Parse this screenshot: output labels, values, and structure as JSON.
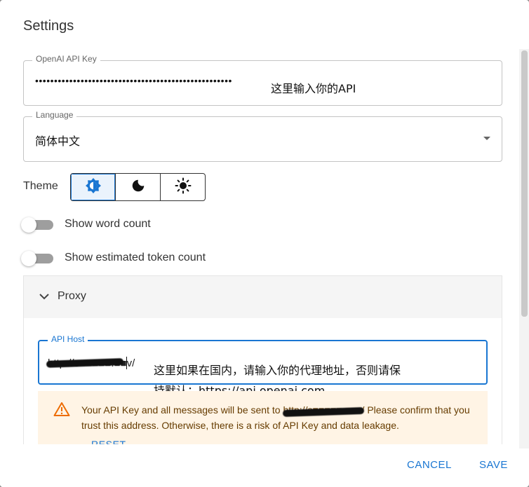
{
  "dialog": {
    "title": "Settings"
  },
  "api_key": {
    "label": "OpenAI API Key",
    "value": "••••••••••••••••••••••••••••••••••••••••••••••••••••",
    "annotation": "这里输入你的API"
  },
  "language": {
    "label": "Language",
    "selected": "简体中文"
  },
  "theme": {
    "label": "Theme",
    "options": [
      {
        "icon": "auto-brightness-icon",
        "selected": true
      },
      {
        "icon": "moon-icon",
        "selected": false
      },
      {
        "icon": "sun-icon",
        "selected": false
      }
    ]
  },
  "toggles": {
    "word_count": {
      "label": "Show word count",
      "on": false
    },
    "token_count": {
      "label": "Show estimated token count",
      "on": false
    }
  },
  "proxy": {
    "label": "Proxy",
    "api_host": {
      "label": "API Host",
      "value": "http://s■■■■■.■■v/",
      "annotation_line1": "这里如果在国内，请输入你的代理地址，否则请保",
      "annotation_line2": "持默认：https://api.openai.com"
    },
    "warning": {
      "text_before": "Your API Key and all messages will be sent to ",
      "url": "http://s■■■■■.■■v/",
      "text_after": " Please confirm that you trust this address. Otherwise, there is a risk of API Key and data leakage.",
      "reset_label": "RESET"
    }
  },
  "actions": {
    "cancel": "CANCEL",
    "save": "SAVE"
  },
  "colors": {
    "primary": "#1976d2",
    "warning_bg": "#fff4e5",
    "warning_icon": "#ed6c02",
    "warning_text": "#663c00"
  }
}
